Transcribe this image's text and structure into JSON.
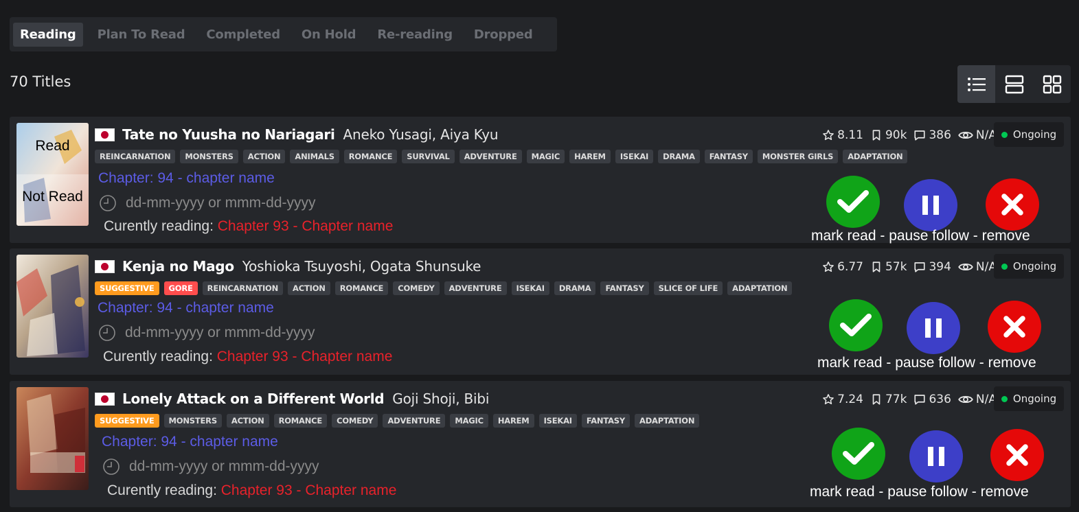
{
  "tabs": [
    {
      "label": "Reading",
      "active": true
    },
    {
      "label": "Plan To Read",
      "active": false
    },
    {
      "label": "Completed",
      "active": false
    },
    {
      "label": "On Hold",
      "active": false
    },
    {
      "label": "Re-reading",
      "active": false
    },
    {
      "label": "Dropped",
      "active": false
    }
  ],
  "count_label": "70 Titles",
  "view_modes": [
    "list-view-icon",
    "rows-view-icon",
    "grid-view-icon"
  ],
  "colors": {
    "chapter": "#5c5ce6",
    "current_chapter": "#e8222b",
    "status_ongoing": "#00c853",
    "mark_read": "#10a418",
    "pause": "#3d3fc8",
    "remove": "#e50909"
  },
  "cover_overlay": {
    "read": "Read",
    "not_read": "Not Read"
  },
  "manga": [
    {
      "title": "Tate no Yuusha no Nariagari",
      "authors": "Aneko Yusagi, Aiya Kyu",
      "tags": [
        "REINCARNATION",
        "MONSTERS",
        "ACTION",
        "ANIMALS",
        "ROMANCE",
        "SURVIVAL",
        "ADVENTURE",
        "MAGIC",
        "HAREM",
        "ISEKAI",
        "DRAMA",
        "FANTASY",
        "MONSTER GIRLS",
        "ADAPTATION"
      ],
      "chapter": "Chapter: 94 - chapter name",
      "date": "dd-mm-yyyy or mmm-dd-yyyy",
      "current_prefix": "Curently reading: ",
      "current_chapter": "Chapter 93 - Chapter name",
      "rating": "8.11",
      "follows": "90k",
      "comments": "386",
      "views": "N/A",
      "status": "Ongoing",
      "actions_label": "mark read - pause follow - remove"
    },
    {
      "title": "Kenja no Mago",
      "authors": "Yoshioka Tsuyoshi, Ogata Shunsuke",
      "tags": [
        "SUGGESTIVE",
        "GORE",
        "REINCARNATION",
        "ACTION",
        "ROMANCE",
        "COMEDY",
        "ADVENTURE",
        "ISEKAI",
        "DRAMA",
        "FANTASY",
        "SLICE OF LIFE",
        "ADAPTATION"
      ],
      "chapter": "Chapter: 94 - chapter name",
      "date": "dd-mm-yyyy or mmm-dd-yyyy",
      "current_prefix": "Curently reading: ",
      "current_chapter": "Chapter 93 - Chapter name",
      "rating": "6.77",
      "follows": "57k",
      "comments": "394",
      "views": "N/A",
      "status": "Ongoing",
      "actions_label": "mark read - pause follow - remove"
    },
    {
      "title": "Lonely Attack on a Different World",
      "authors": "Goji Shoji, Bibi",
      "tags": [
        "SUGGESTIVE",
        "MONSTERS",
        "ACTION",
        "ROMANCE",
        "COMEDY",
        "ADVENTURE",
        "MAGIC",
        "HAREM",
        "ISEKAI",
        "FANTASY",
        "ADAPTATION"
      ],
      "chapter": "Chapter: 94 - chapter name",
      "date": "dd-mm-yyyy or mmm-dd-yyyy",
      "current_prefix": "Curently reading: ",
      "current_chapter": "Chapter 93 - Chapter name",
      "rating": "7.24",
      "follows": "77k",
      "comments": "636",
      "views": "N/A",
      "status": "Ongoing",
      "actions_label": "mark read - pause follow - remove"
    }
  ]
}
